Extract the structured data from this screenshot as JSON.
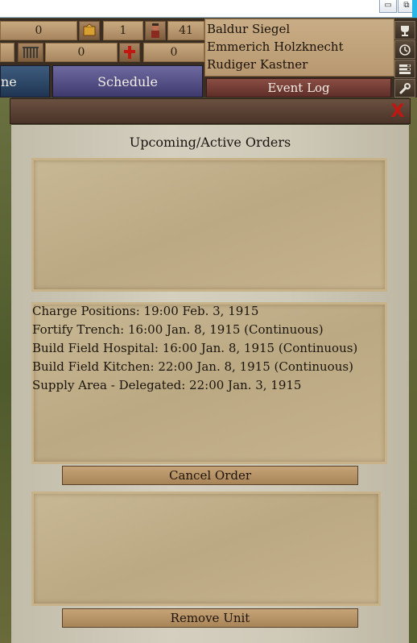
{
  "window": {
    "minimize_glyph": "▭",
    "restore_glyph": "⧉"
  },
  "resources": {
    "row1_value_a": "0",
    "row1_value_b": "1",
    "row1_value_c": "41",
    "row2_value_a": "0",
    "row2_value_b": "0"
  },
  "officers": [
    "Baldur Siegel",
    "Emmerich Holzknecht",
    "Rudiger Kastner"
  ],
  "tabs": {
    "left_partial": "ne",
    "schedule": "Schedule"
  },
  "event_log_label": "Event Log",
  "dialog": {
    "close_glyph": "X",
    "title": "Upcoming/Active Orders",
    "orders": [
      "Charge Positions: 19:00 Feb. 3, 1915",
      "Fortify Trench: 16:00 Jan. 8, 1915 (Continuous)",
      "Build Field Hospital: 16:00 Jan. 8, 1915 (Continuous)",
      "Build Field Kitchen: 22:00 Jan. 8, 1915 (Continuous)",
      "Supply Area - Delegated: 22:00 Jan. 3, 1915"
    ],
    "cancel_label": "Cancel Order",
    "remove_label": "Remove Unit"
  },
  "icons": {
    "supply": "supply-crate-icon",
    "soldier": "soldier-icon",
    "fortification": "fence-icon",
    "medical": "red-cross-icon",
    "trophy": "trophy-icon",
    "clock": "clock-icon",
    "list": "list-icon",
    "wrench": "wrench-icon"
  },
  "colors": {
    "close": "#c01810",
    "medical": "#c01810",
    "schedule_tab": "#5a5690",
    "event_log": "#7a4038"
  }
}
